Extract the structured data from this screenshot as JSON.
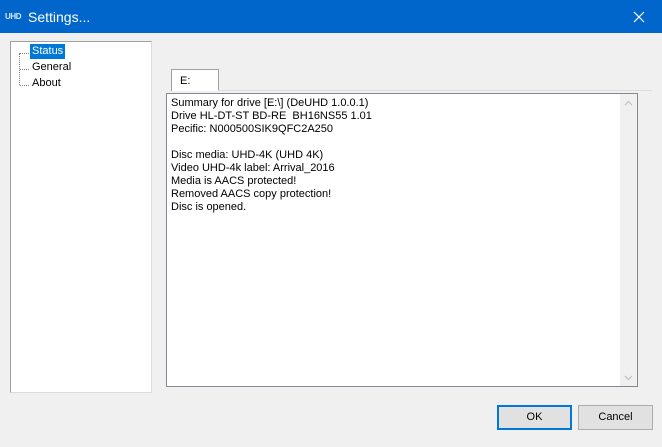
{
  "window": {
    "logo_text": "UHD",
    "title": "Settings...",
    "close_icon": "close-icon"
  },
  "tree": {
    "items": [
      {
        "label": "Status",
        "selected": true
      },
      {
        "label": "General",
        "selected": false
      },
      {
        "label": "About",
        "selected": false
      }
    ]
  },
  "tab": {
    "label": "E:"
  },
  "summary": {
    "lines": [
      "Summary for drive [E:\\] (DeUHD 1.0.0.1)",
      "Drive HL-DT-ST BD-RE  BH16NS55 1.01",
      "Pecific: N000500SIK9QFC2A250",
      "",
      "Disc media: UHD-4K (UHD 4K)",
      "Video UHD-4k label: Arrival_2016",
      "Media is AACS protected!",
      "Removed AACS copy protection!",
      "Disc is opened."
    ]
  },
  "buttons": {
    "ok": "OK",
    "cancel": "Cancel"
  },
  "colors": {
    "titlebar": "#0066cc",
    "selection": "#0078d7"
  }
}
